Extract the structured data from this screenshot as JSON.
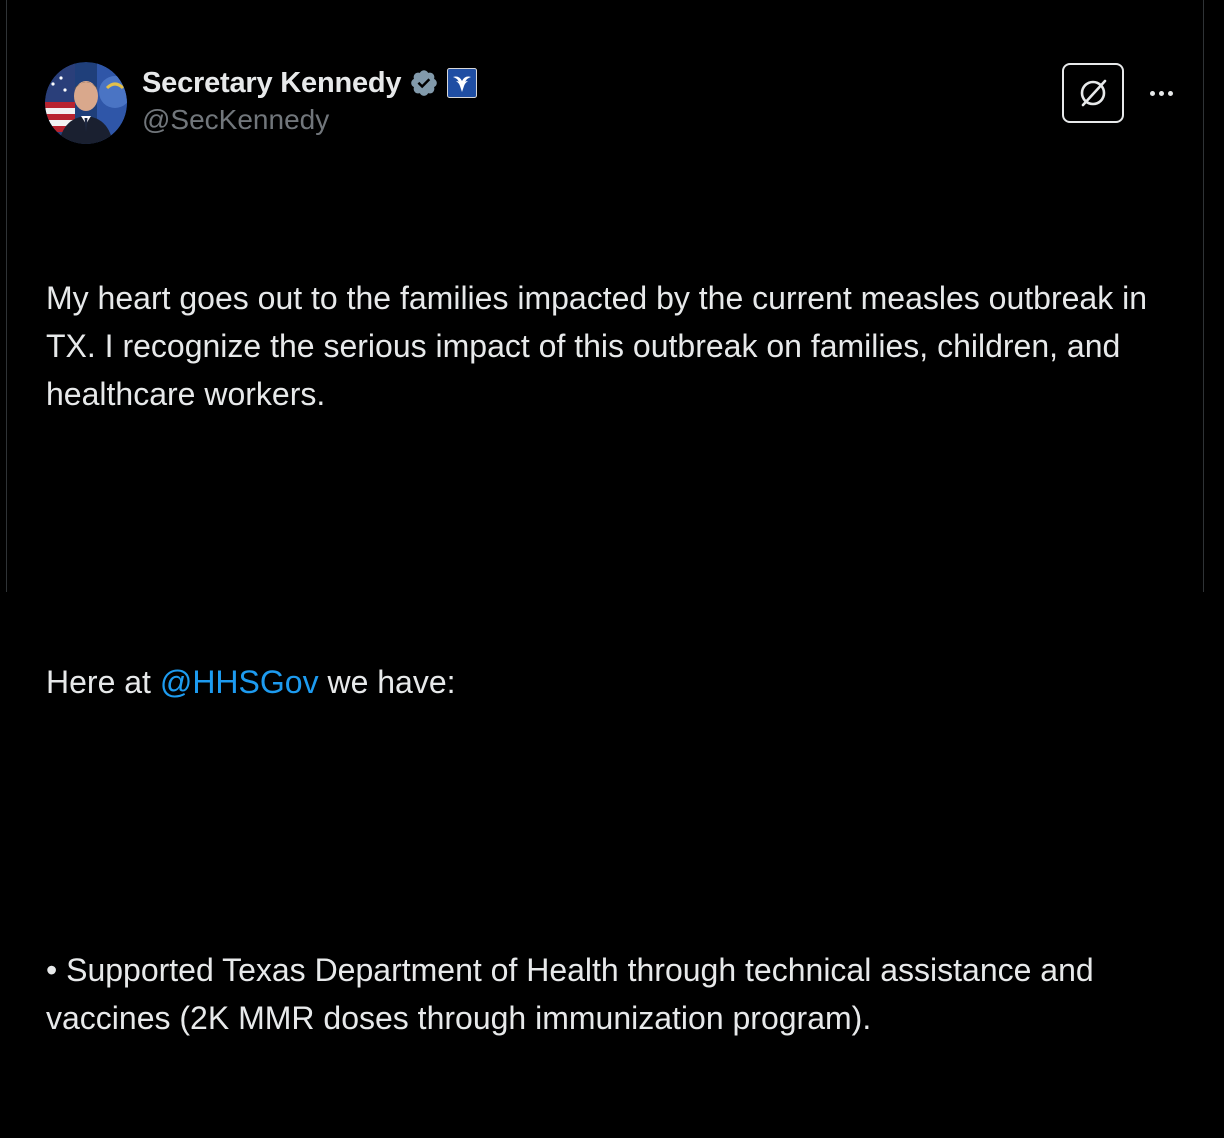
{
  "author": {
    "display_name": "Secretary Kennedy",
    "handle": "@SecKennedy",
    "verified": true,
    "verified_badge_color": "#829aab",
    "affiliation_badge": "hhs-eagle-icon"
  },
  "actions": {
    "grok_icon": "grok-slash-icon",
    "more_icon": "more-dots-icon"
  },
  "tweet": {
    "paragraph_1": "My heart goes out to the families impacted by the current measles outbreak in TX. I recognize the serious impact of this outbreak on families, children, and healthcare workers.",
    "paragraph_2_prefix": "Here at ",
    "paragraph_2_mention": "@HHSGov",
    "paragraph_2_suffix": " we have:",
    "bullet_1": "• Supported Texas Department of Health through technical assistance and vaccines (2K MMR doses through immunization program)."
  },
  "colors": {
    "background": "#000000",
    "text": "#e7e9ea",
    "secondary_text": "#71767b",
    "link": "#1d9bf0"
  }
}
